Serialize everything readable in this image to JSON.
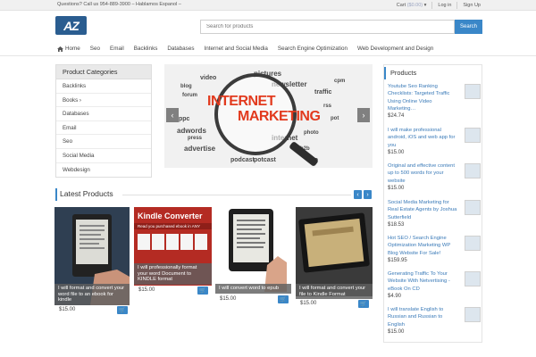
{
  "topbar": {
    "contact": "Questions? Call us 954-889-3900 – Hablamos Espanol –",
    "cart_label": "Cart",
    "cart_price": "($0.00)",
    "login": "Log in",
    "signup": "Sign Up"
  },
  "header": {
    "logo_text": "AZ",
    "search_placeholder": "Search for products",
    "search_button": "Search"
  },
  "nav": {
    "items": [
      "Home",
      "Seo",
      "Email",
      "Backlinks",
      "Databases",
      "Internet and Social Media",
      "Search Engine Optimization",
      "Web Development and Design"
    ]
  },
  "categories": {
    "title": "Product Categories",
    "items": [
      "Backlinks",
      "Books ›",
      "Databases",
      "Email",
      "Seo",
      "Social Media",
      "Webdesign"
    ]
  },
  "slider": {
    "headline_1": "INTERNET",
    "headline_2": "MARKETING",
    "words": [
      "video",
      "pictures",
      "newsletter",
      "traffic",
      "blog",
      "forum",
      "rss",
      "cpm",
      "adwords",
      "press",
      "pot",
      "advertise",
      "photo",
      "internet",
      "ppc",
      "b2b",
      "podcast",
      "potcast",
      "seo"
    ]
  },
  "latest": {
    "title": "Latest Products",
    "products": [
      {
        "caption": "I will format and convert your word file to an ebook for kindle",
        "price": "$15.00"
      },
      {
        "caption": "I will professionally format your word Document to KINDLE format",
        "price": "$15.00",
        "banner_title": "Kindle Converter",
        "banner_sub": "Read you purchased ebook in ANY"
      },
      {
        "caption": "I will convert word to epub",
        "price": "$15.00"
      },
      {
        "caption": "I will format and convert your file to Kindle Format",
        "price": "$15.00"
      }
    ]
  },
  "products": {
    "title": "Products",
    "items": [
      {
        "title": "Youtube Seo Ranking Checklists: Targeted Traffic Using Online Video Marketing…",
        "price": "$24.74"
      },
      {
        "title": "I will make professional android, iOS and web app for you",
        "price": "$15.00"
      },
      {
        "title": "Original and effective content up to 500 words for your website",
        "price": "$15.00"
      },
      {
        "title": "Social Media Marketing for Real Estate Agents by Joshua Sutterfield",
        "price": "$18.53"
      },
      {
        "title": "Hot SEO / Search Engine Optimization Marketing WP Blog Website For Sale!",
        "price": "$159.95"
      },
      {
        "title": "Generating Traffic To Your Website With Netvertising - eBook On CD",
        "price": "$4.90"
      },
      {
        "title": "I will translate English to Russian and Russian to English",
        "price": "$15.00"
      }
    ]
  },
  "colors": {
    "accent": "#3a87c8",
    "logo": "#2a5d90",
    "highlight": "#e23a1e"
  }
}
